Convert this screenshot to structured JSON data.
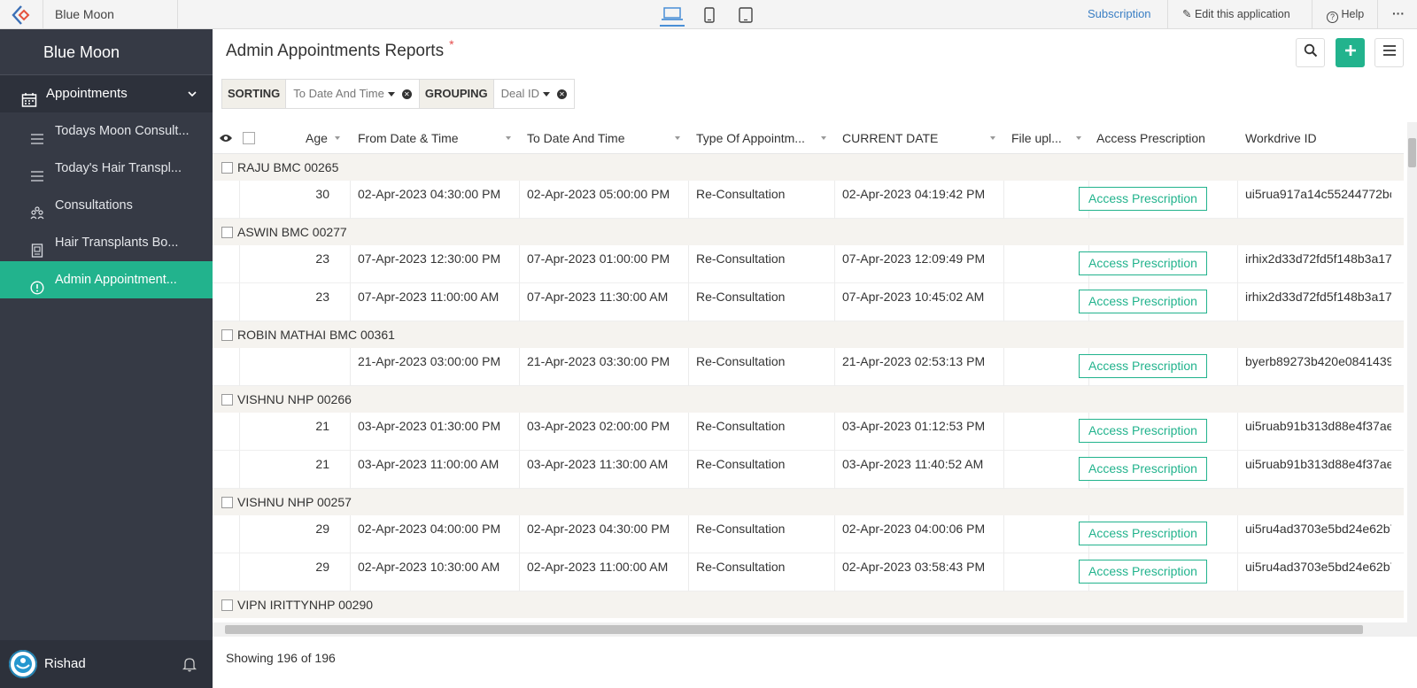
{
  "topbar": {
    "app_name": "Blue Moon",
    "subscription": "Subscription",
    "edit": "Edit this application",
    "help": "Help",
    "more": "···"
  },
  "sidebar": {
    "brand": "Blue Moon",
    "section_label": "Appointments",
    "items": [
      {
        "label": "Todays Moon Consult..."
      },
      {
        "label": "Today's Hair Transpl..."
      },
      {
        "label": "Consultations"
      },
      {
        "label": "Hair Transplants Bo..."
      },
      {
        "label": "Admin Appointment..."
      }
    ],
    "user": "Rishad"
  },
  "main": {
    "title": "Admin Appointments Reports",
    "required_mark": "*",
    "sorting_label": "SORTING",
    "sorting_value": "To Date And Time",
    "grouping_label": "GROUPING",
    "grouping_value": "Deal ID",
    "footer": "Showing 196 of 196",
    "accent_color": "#22b38d"
  },
  "table": {
    "columns": [
      "Age",
      "From Date & Time",
      "To Date And Time",
      "Type Of Appointm...",
      "CURRENT DATE",
      "File upl...",
      "Access Prescription",
      "Workdrive ID"
    ],
    "button_label": "Access Prescription",
    "groups": [
      {
        "name": "RAJU BMC 00265",
        "rows": [
          {
            "age": "30",
            "from": "02-Apr-2023 04:30:00 PM",
            "to": "02-Apr-2023 05:00:00 PM",
            "type": "Re-Consultation",
            "current": "02-Apr-2023 04:19:42 PM",
            "wd": "ui5rua917a14c55244772bc"
          }
        ]
      },
      {
        "name": "ASWIN BMC 00277",
        "rows": [
          {
            "age": "23",
            "from": "07-Apr-2023 12:30:00 PM",
            "to": "07-Apr-2023 01:00:00 PM",
            "type": "Re-Consultation",
            "current": "07-Apr-2023 12:09:49 PM",
            "wd": "irhix2d33d72fd5f148b3a17"
          },
          {
            "age": "23",
            "from": "07-Apr-2023 11:00:00 AM",
            "to": "07-Apr-2023 11:30:00 AM",
            "type": "Re-Consultation",
            "current": "07-Apr-2023 10:45:02 AM",
            "wd": "irhix2d33d72fd5f148b3a17"
          }
        ]
      },
      {
        "name": "ROBIN MATHAI BMC 00361",
        "rows": [
          {
            "age": "",
            "from": "21-Apr-2023 03:00:00 PM",
            "to": "21-Apr-2023 03:30:00 PM",
            "type": "Re-Consultation",
            "current": "21-Apr-2023 02:53:13 PM",
            "wd": "byerb89273b420e0841439"
          }
        ]
      },
      {
        "name": "VISHNU NHP 00266",
        "rows": [
          {
            "age": "21",
            "from": "03-Apr-2023 01:30:00 PM",
            "to": "03-Apr-2023 02:00:00 PM",
            "type": "Re-Consultation",
            "current": "03-Apr-2023 01:12:53 PM",
            "wd": "ui5ruab91b313d88e4f37ae"
          },
          {
            "age": "21",
            "from": "03-Apr-2023 11:00:00 AM",
            "to": "03-Apr-2023 11:30:00 AM",
            "type": "Re-Consultation",
            "current": "03-Apr-2023 11:40:52 AM",
            "wd": "ui5ruab91b313d88e4f37ae"
          }
        ]
      },
      {
        "name": "VISHNU NHP 00257",
        "rows": [
          {
            "age": "29",
            "from": "02-Apr-2023 04:00:00 PM",
            "to": "02-Apr-2023 04:30:00 PM",
            "type": "Re-Consultation",
            "current": "02-Apr-2023 04:00:06 PM",
            "wd": "ui5ru4ad3703e5bd24e62b7"
          },
          {
            "age": "29",
            "from": "02-Apr-2023 10:30:00 AM",
            "to": "02-Apr-2023 11:00:00 AM",
            "type": "Re-Consultation",
            "current": "02-Apr-2023 03:58:43 PM",
            "wd": "ui5ru4ad3703e5bd24e62b7"
          }
        ]
      },
      {
        "name": "VIPN IRITTYNHP 00290",
        "rows": []
      }
    ]
  }
}
